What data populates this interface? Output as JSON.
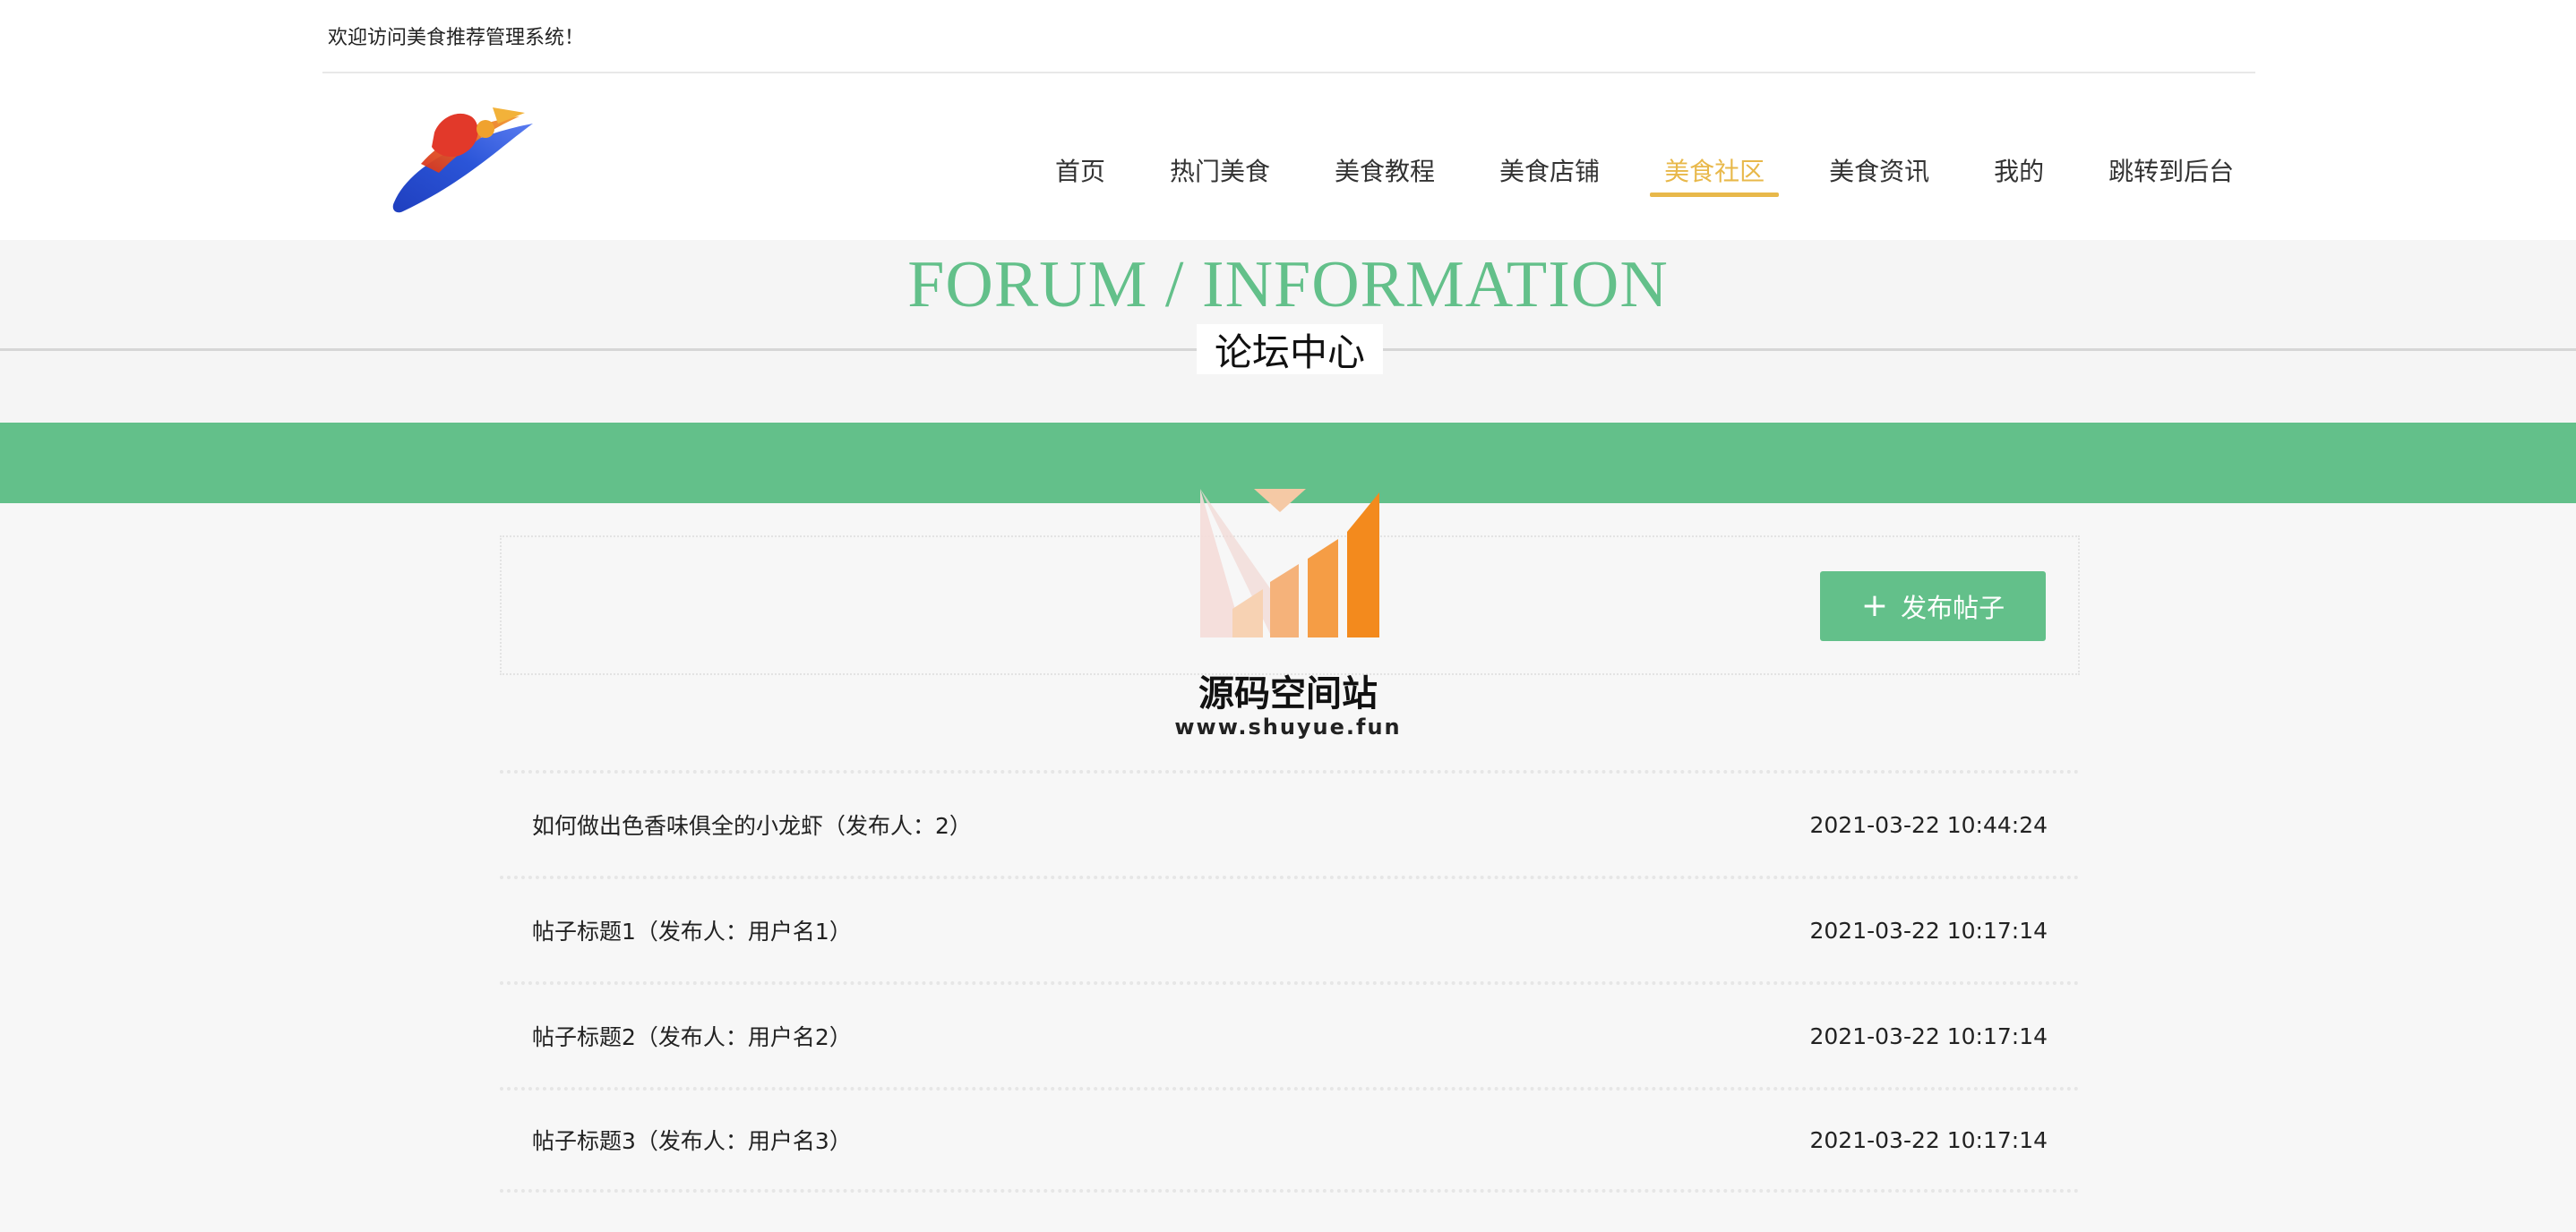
{
  "header": {
    "welcome": "欢迎访问美食推荐管理系统！",
    "nav": [
      {
        "label": "首页",
        "active": false
      },
      {
        "label": "热门美食",
        "active": false
      },
      {
        "label": "美食教程",
        "active": false
      },
      {
        "label": "美食店铺",
        "active": false
      },
      {
        "label": "美食社区",
        "active": true
      },
      {
        "label": "美食资讯",
        "active": false
      },
      {
        "label": "我的",
        "active": false
      },
      {
        "label": "跳转到后台",
        "active": false
      }
    ]
  },
  "section": {
    "title_en": "FORUM / INFORMATION",
    "title_cn": "论坛中心"
  },
  "publish": {
    "label": "发布帖子",
    "icon": "plus-icon"
  },
  "watermark": {
    "title": "源码空间站",
    "url": "www.shuyue.fun"
  },
  "posts": [
    {
      "title": "如何做出色香味俱全的小龙虾（发布人：2）",
      "time": "2021-03-22 10:44:24"
    },
    {
      "title": "帖子标题1（发布人：用户名1）",
      "time": "2021-03-22 10:17:14"
    },
    {
      "title": "帖子标题2（发布人：用户名2）",
      "time": "2021-03-22 10:17:14"
    },
    {
      "title": "帖子标题3（发布人：用户名3）",
      "time": "2021-03-22 10:17:14"
    }
  ],
  "colors": {
    "accent_green": "#63c08a",
    "active_nav": "#e8b84a"
  }
}
